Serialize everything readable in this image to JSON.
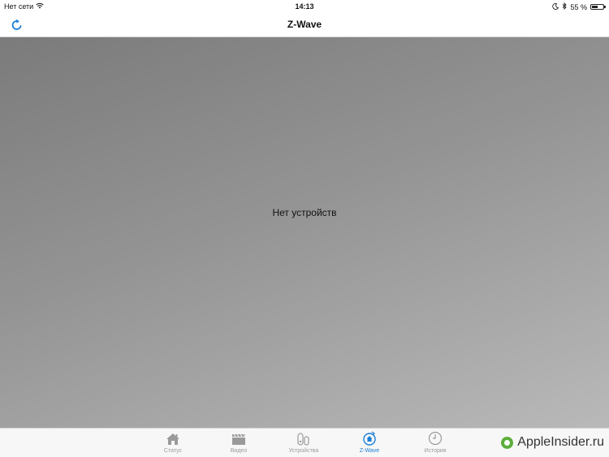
{
  "status_bar": {
    "carrier": "Нет сети",
    "time": "14:13",
    "battery": "55 %",
    "battery_level": 0.55
  },
  "nav": {
    "title": "Z-Wave"
  },
  "content": {
    "empty_message": "Нет устройств"
  },
  "tabs": [
    {
      "label": "Статус",
      "icon": "home-icon"
    },
    {
      "label": "Видео",
      "icon": "clapperboard-icon"
    },
    {
      "label": "Устройства",
      "icon": "devices-icon"
    },
    {
      "label": "Z-Wave",
      "icon": "zwave-icon",
      "active": true
    },
    {
      "label": "История",
      "icon": "clock-icon"
    }
  ],
  "watermark": {
    "text": "AppleInsider.ru"
  },
  "colors": {
    "accent": "#1a7ed6",
    "inactive": "#9a9a9a",
    "logo_green": "#5cae3b"
  }
}
